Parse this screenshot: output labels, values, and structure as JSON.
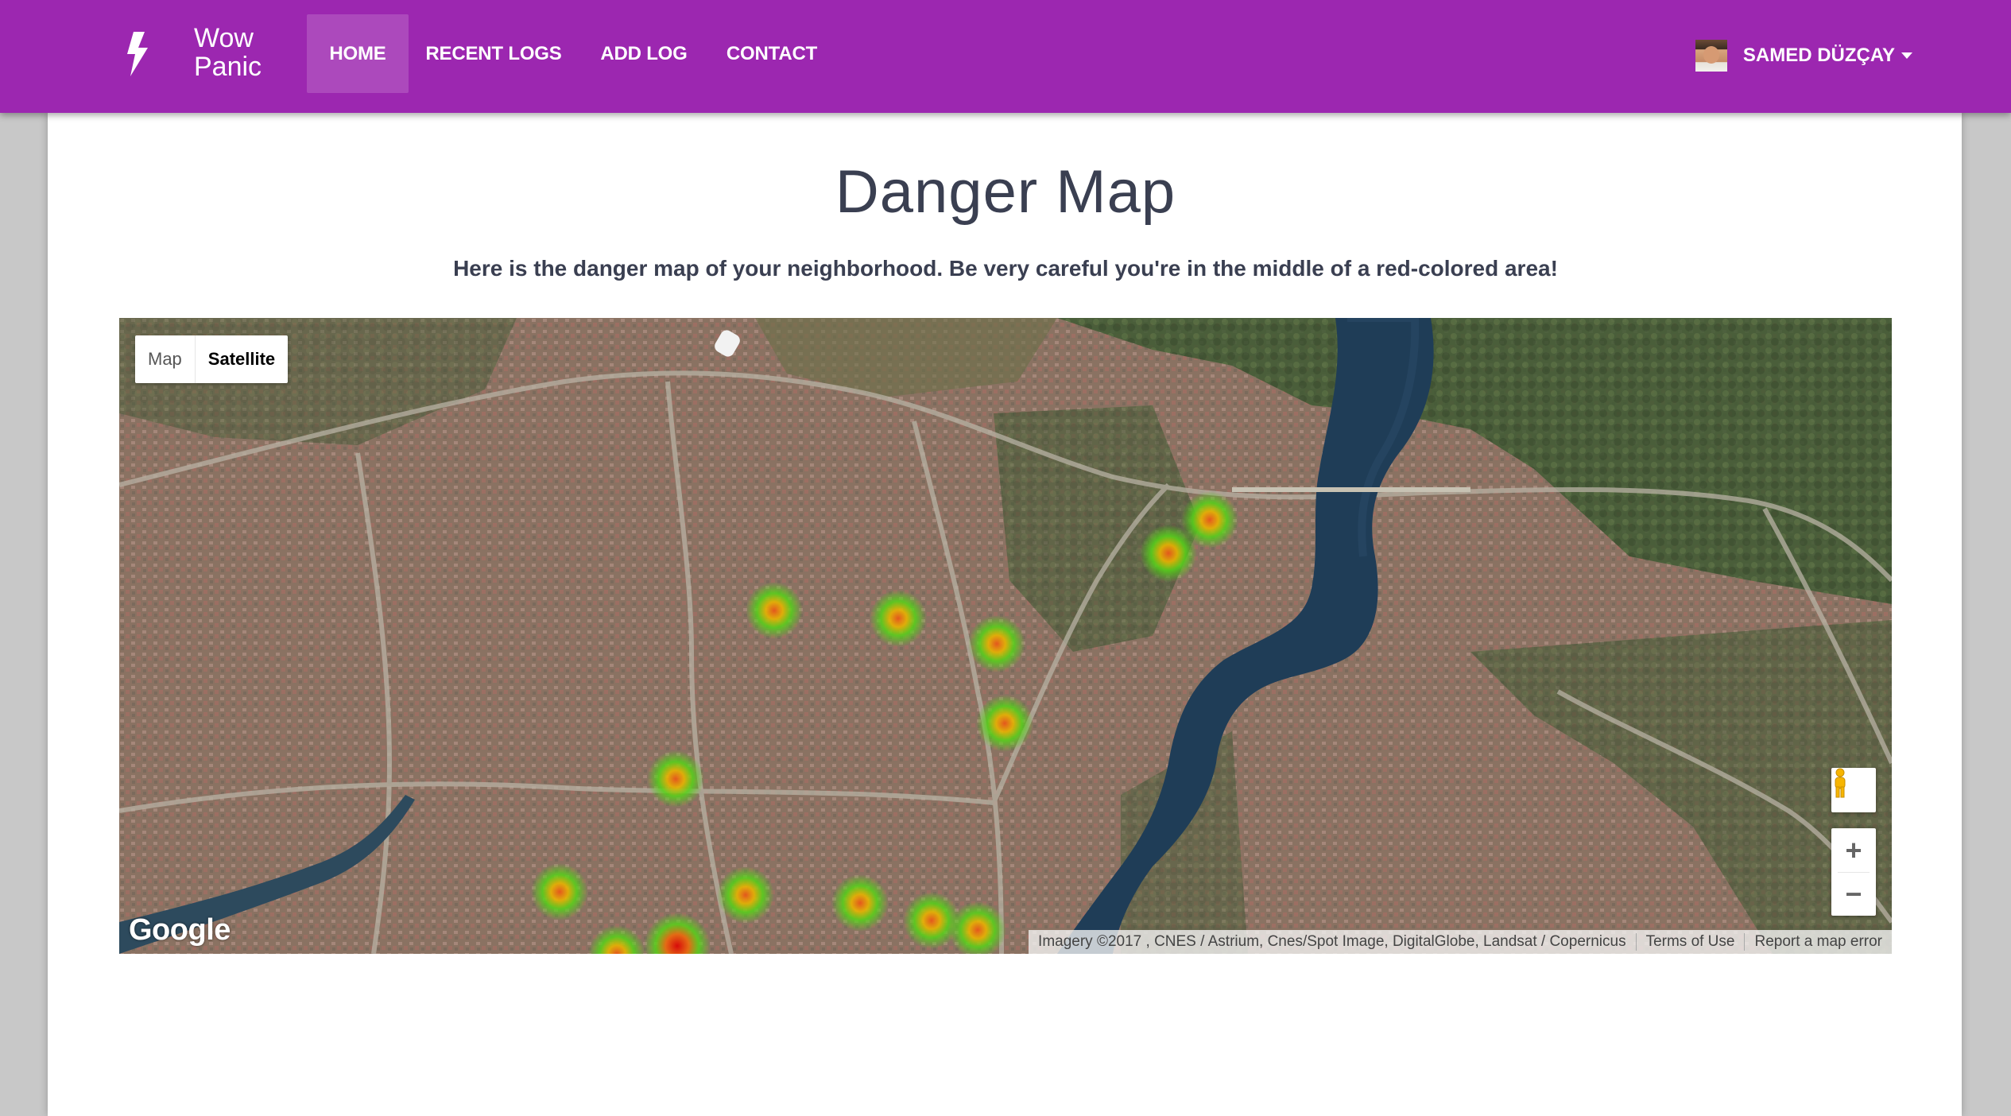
{
  "brand": {
    "line1": "Wow",
    "line2": "Panic",
    "icon": "lightning-bolt-icon"
  },
  "nav": {
    "items": [
      {
        "label": "HOME",
        "active": true
      },
      {
        "label": "RECENT LOGS",
        "active": false
      },
      {
        "label": "ADD LOG",
        "active": false
      },
      {
        "label": "CONTACT",
        "active": false
      }
    ]
  },
  "user": {
    "name": "SAMED DÜZÇAY",
    "icon": "chevron-down-icon"
  },
  "page": {
    "title": "Danger Map",
    "subtitle": "Here is the danger map of your neighborhood. Be very careful you're in the middle of a red-colored area!"
  },
  "map": {
    "type_buttons": {
      "map": "Map",
      "satellite": "Satellite",
      "selected": "Satellite"
    },
    "google_logo": "Google",
    "attribution": "Imagery ©2017 , CNES / Astrium, Cnes/Spot Image, DigitalGlobe, Landsat / Copernicus",
    "terms": "Terms of Use",
    "report": "Report a map error",
    "zoom_in": "+",
    "zoom_out": "−"
  },
  "colors": {
    "navbar": "#9c27b0",
    "text_dark": "#3a3f51",
    "heat_low": "#4cd11e",
    "heat_mid": "#f2a900",
    "heat_high": "#e01010"
  }
}
